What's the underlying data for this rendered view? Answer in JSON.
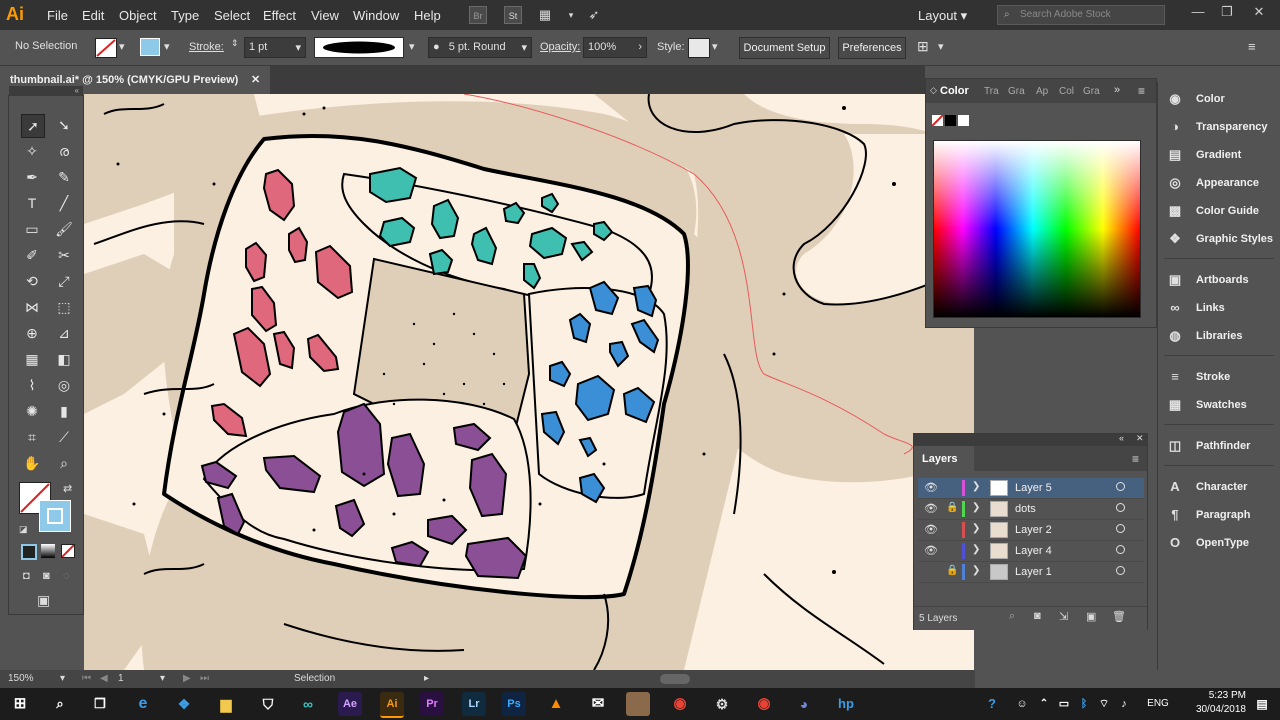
{
  "app": {
    "logo": "Ai"
  },
  "menu": [
    "File",
    "Edit",
    "Object",
    "Type",
    "Select",
    "Effect",
    "View",
    "Window",
    "Help"
  ],
  "workspace": {
    "label": "Layout",
    "search_placeholder": "Search Adobe Stock"
  },
  "control_bar": {
    "selection": "No Selection",
    "stroke_label": "Stroke:",
    "stroke_weight": "1 pt",
    "brush": "5 pt. Round",
    "opacity_label": "Opacity:",
    "opacity_value": "100%",
    "style_label": "Style:",
    "document_setup": "Document Setup",
    "preferences": "Preferences"
  },
  "document": {
    "tab_title": "thumbnail.ai* @ 150% (CMYK/GPU Preview)"
  },
  "color_panel": {
    "title": "Color",
    "tabs": [
      "Tra",
      "Gra",
      "Ap",
      "Col",
      "Gra"
    ]
  },
  "dock": {
    "group1": [
      {
        "label": "Color",
        "icon": "palette-icon"
      },
      {
        "label": "Transparency",
        "icon": "transparency-icon"
      },
      {
        "label": "Gradient",
        "icon": "gradient-icon"
      },
      {
        "label": "Appearance",
        "icon": "appearance-icon"
      },
      {
        "label": "Color Guide",
        "icon": "color-guide-icon"
      },
      {
        "label": "Graphic Styles",
        "icon": "graphic-styles-icon"
      }
    ],
    "group2": [
      {
        "label": "Artboards",
        "icon": "artboards-icon"
      },
      {
        "label": "Links",
        "icon": "links-icon"
      },
      {
        "label": "Libraries",
        "icon": "libraries-icon"
      }
    ],
    "group3": [
      {
        "label": "Stroke",
        "icon": "stroke-icon"
      },
      {
        "label": "Swatches",
        "icon": "swatches-icon"
      }
    ],
    "group4": [
      {
        "label": "Pathfinder",
        "icon": "pathfinder-icon"
      }
    ],
    "group5": [
      {
        "label": "Character",
        "icon": "character-icon"
      },
      {
        "label": "Paragraph",
        "icon": "paragraph-icon"
      },
      {
        "label": "OpenType",
        "icon": "opentype-icon"
      }
    ]
  },
  "layers_panel": {
    "title": "Layers",
    "count": "5 Layers",
    "layers": [
      {
        "name": "Layer 5",
        "color": "#d84fd8",
        "visible": true,
        "locked": false,
        "selected": true
      },
      {
        "name": "dots",
        "color": "#4fd84f",
        "visible": true,
        "locked": true,
        "selected": false
      },
      {
        "name": "Layer 2",
        "color": "#d84f4f",
        "visible": true,
        "locked": false,
        "selected": false
      },
      {
        "name": "Layer 4",
        "color": "#4f4fd8",
        "visible": true,
        "locked": false,
        "selected": false
      },
      {
        "name": "Layer 1",
        "color": "#4f7fd8",
        "visible": false,
        "locked": true,
        "selected": false
      }
    ]
  },
  "status_bar": {
    "zoom": "150%",
    "artboard": "1",
    "tool": "Selection"
  },
  "taskbar": {
    "time": "5:23 PM",
    "date": "30/04/2018",
    "lang": "ENG"
  }
}
